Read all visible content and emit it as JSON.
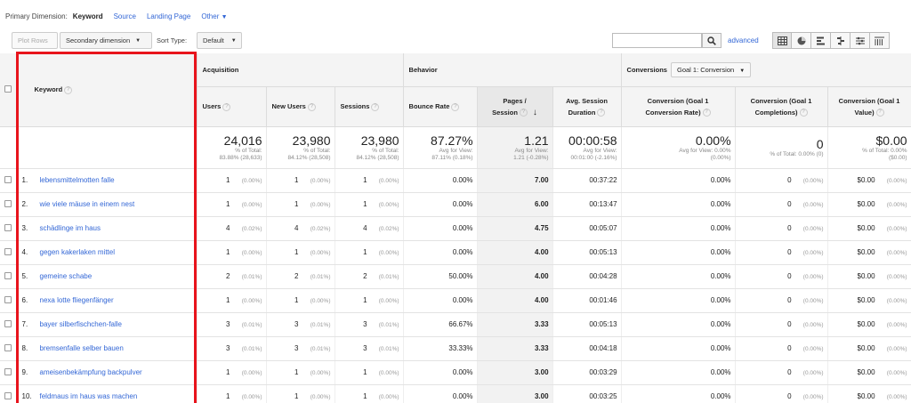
{
  "dimension_bar": {
    "label": "Primary Dimension:",
    "active": "Keyword",
    "options": [
      "Source",
      "Landing Page",
      "Other"
    ]
  },
  "toolbar": {
    "plot_rows": "Plot Rows",
    "secondary_dimension": "Secondary dimension",
    "sort_type_label": "Sort Type:",
    "sort_type_value": "Default",
    "search_value": "",
    "advanced": "advanced"
  },
  "groups": {
    "acquisition": "Acquisition",
    "behavior": "Behavior",
    "conversions": "Conversions",
    "goal_select": "Goal 1: Conversion"
  },
  "columns": {
    "keyword": "Keyword",
    "users": "Users",
    "new_users": "New Users",
    "sessions": "Sessions",
    "bounce_rate": "Bounce Rate",
    "pages_session_1": "Pages /",
    "pages_session_2": "Session",
    "avg_duration_1": "Avg. Session",
    "avg_duration_2": "Duration",
    "conv_rate_1": "Conversion (Goal 1",
    "conv_rate_2": "Conversion Rate)",
    "completions_1": "Conversion (Goal 1",
    "completions_2": "Completions)",
    "value_1": "Conversion (Goal 1",
    "value_2": "Value)"
  },
  "totals": {
    "users": {
      "value": "24,016",
      "l1": "% of Total:",
      "l2": "83.88% (28,633)"
    },
    "new_users": {
      "value": "23,980",
      "l1": "% of Total:",
      "l2": "84.12% (28,508)"
    },
    "sessions": {
      "value": "23,980",
      "l1": "% of Total:",
      "l2": "84.12% (28,508)"
    },
    "bounce_rate": {
      "value": "87.27%",
      "l1": "Avg for View:",
      "l2": "87.11% (0.18%)"
    },
    "pages_session": {
      "value": "1.21",
      "l1": "Avg for View:",
      "l2": "1.21 (-0.28%)"
    },
    "avg_duration": {
      "value": "00:00:58",
      "l1": "Avg for View:",
      "l2": "00:01:00 (-2.16%)"
    },
    "conv_rate": {
      "value": "0.00%",
      "l1": "Avg for View: 0.00%",
      "l2": "(0.00%)"
    },
    "completions": {
      "value": "0",
      "l1": "% of Total: 0.00% (0)",
      "l2": ""
    },
    "value": {
      "value": "$0.00",
      "l1": "% of Total: 0.00%",
      "l2": "($0.00)"
    }
  },
  "rows": [
    {
      "idx": "1.",
      "keyword": "lebensmittelmotten falle",
      "users": "1",
      "users_pct": "(0.00%)",
      "new_users": "1",
      "new_users_pct": "(0.00%)",
      "sessions": "1",
      "sessions_pct": "(0.00%)",
      "bounce": "0.00%",
      "pages": "7.00",
      "duration": "00:37:22",
      "conv_rate": "0.00%",
      "completions": "0",
      "completions_pct": "(0.00%)",
      "value": "$0.00",
      "value_pct": "(0.00%)"
    },
    {
      "idx": "2.",
      "keyword": "wie viele mäuse in einem nest",
      "users": "1",
      "users_pct": "(0.00%)",
      "new_users": "1",
      "new_users_pct": "(0.00%)",
      "sessions": "1",
      "sessions_pct": "(0.00%)",
      "bounce": "0.00%",
      "pages": "6.00",
      "duration": "00:13:47",
      "conv_rate": "0.00%",
      "completions": "0",
      "completions_pct": "(0.00%)",
      "value": "$0.00",
      "value_pct": "(0.00%)"
    },
    {
      "idx": "3.",
      "keyword": "schädlinge im haus",
      "users": "4",
      "users_pct": "(0.02%)",
      "new_users": "4",
      "new_users_pct": "(0.02%)",
      "sessions": "4",
      "sessions_pct": "(0.02%)",
      "bounce": "0.00%",
      "pages": "4.75",
      "duration": "00:05:07",
      "conv_rate": "0.00%",
      "completions": "0",
      "completions_pct": "(0.00%)",
      "value": "$0.00",
      "value_pct": "(0.00%)"
    },
    {
      "idx": "4.",
      "keyword": "gegen kakerlaken mittel",
      "users": "1",
      "users_pct": "(0.00%)",
      "new_users": "1",
      "new_users_pct": "(0.00%)",
      "sessions": "1",
      "sessions_pct": "(0.00%)",
      "bounce": "0.00%",
      "pages": "4.00",
      "duration": "00:05:13",
      "conv_rate": "0.00%",
      "completions": "0",
      "completions_pct": "(0.00%)",
      "value": "$0.00",
      "value_pct": "(0.00%)"
    },
    {
      "idx": "5.",
      "keyword": "gemeine schabe",
      "users": "2",
      "users_pct": "(0.01%)",
      "new_users": "2",
      "new_users_pct": "(0.01%)",
      "sessions": "2",
      "sessions_pct": "(0.01%)",
      "bounce": "50.00%",
      "pages": "4.00",
      "duration": "00:04:28",
      "conv_rate": "0.00%",
      "completions": "0",
      "completions_pct": "(0.00%)",
      "value": "$0.00",
      "value_pct": "(0.00%)"
    },
    {
      "idx": "6.",
      "keyword": "nexa lotte fliegenfänger",
      "users": "1",
      "users_pct": "(0.00%)",
      "new_users": "1",
      "new_users_pct": "(0.00%)",
      "sessions": "1",
      "sessions_pct": "(0.00%)",
      "bounce": "0.00%",
      "pages": "4.00",
      "duration": "00:01:46",
      "conv_rate": "0.00%",
      "completions": "0",
      "completions_pct": "(0.00%)",
      "value": "$0.00",
      "value_pct": "(0.00%)"
    },
    {
      "idx": "7.",
      "keyword": "bayer silberfischchen-falle",
      "users": "3",
      "users_pct": "(0.01%)",
      "new_users": "3",
      "new_users_pct": "(0.01%)",
      "sessions": "3",
      "sessions_pct": "(0.01%)",
      "bounce": "66.67%",
      "pages": "3.33",
      "duration": "00:05:13",
      "conv_rate": "0.00%",
      "completions": "0",
      "completions_pct": "(0.00%)",
      "value": "$0.00",
      "value_pct": "(0.00%)"
    },
    {
      "idx": "8.",
      "keyword": "bremsenfalle selber bauen",
      "users": "3",
      "users_pct": "(0.01%)",
      "new_users": "3",
      "new_users_pct": "(0.01%)",
      "sessions": "3",
      "sessions_pct": "(0.01%)",
      "bounce": "33.33%",
      "pages": "3.33",
      "duration": "00:04:18",
      "conv_rate": "0.00%",
      "completions": "0",
      "completions_pct": "(0.00%)",
      "value": "$0.00",
      "value_pct": "(0.00%)"
    },
    {
      "idx": "9.",
      "keyword": "ameisenbekämpfung backpulver",
      "users": "1",
      "users_pct": "(0.00%)",
      "new_users": "1",
      "new_users_pct": "(0.00%)",
      "sessions": "1",
      "sessions_pct": "(0.00%)",
      "bounce": "0.00%",
      "pages": "3.00",
      "duration": "00:03:29",
      "conv_rate": "0.00%",
      "completions": "0",
      "completions_pct": "(0.00%)",
      "value": "$0.00",
      "value_pct": "(0.00%)"
    },
    {
      "idx": "10.",
      "keyword": "feldmaus im haus was machen",
      "users": "1",
      "users_pct": "(0.00%)",
      "new_users": "1",
      "new_users_pct": "(0.00%)",
      "sessions": "1",
      "sessions_pct": "(0.00%)",
      "bounce": "0.00%",
      "pages": "3.00",
      "duration": "00:03:25",
      "conv_rate": "0.00%",
      "completions": "0",
      "completions_pct": "(0.00%)",
      "value": "$0.00",
      "value_pct": "(0.00%)"
    }
  ],
  "colors": {
    "link": "#3367d6",
    "highlight_box": "#e8141c"
  }
}
